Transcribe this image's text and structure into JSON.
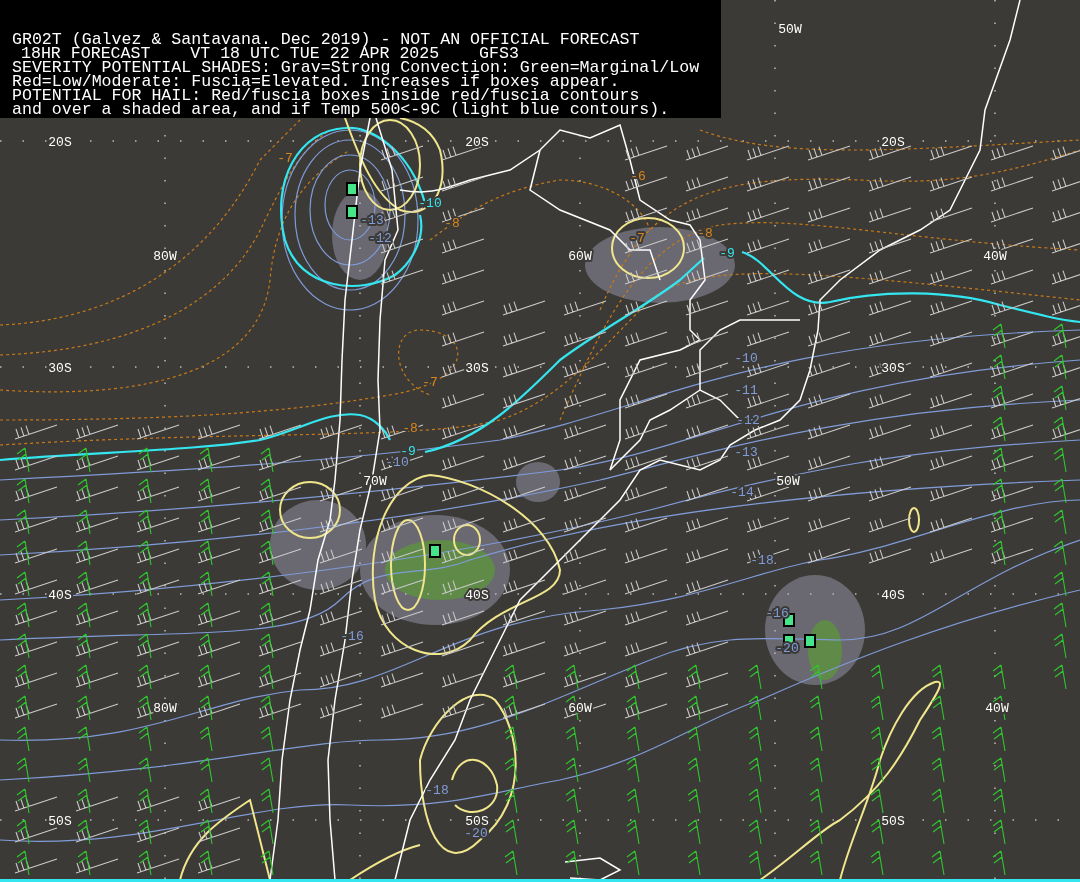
{
  "header": {
    "lines": [
      "GR02T (Galvez & Santavana. Dec 2019) - NOT AN OFFICIAL FORECAST",
      "18HR FORECAST    VT 18 UTC TUE 22 APR 2025    GFS3",
      "SEVERITY POTENTIAL SHADES: Grav=Strong Convection: Green=Marginal/Low",
      "Red=Low/Moderate: Fuscia=Elevated. Increases if boxes appear.",
      "POTENTIAL FOR HAIL: Red/fuscia boxes inside red/fuscia contours",
      "and over a shaded area, and if Temp 500<-9C (light blue contours)."
    ]
  },
  "grid_labels": [
    "50W",
    "20S",
    "20S",
    "20S",
    "80W",
    "60W",
    "40W",
    "30S",
    "30S",
    "30S",
    "70W",
    "50W",
    "40S",
    "40S",
    "40S",
    "80W",
    "60W",
    "40W",
    "50S",
    "50S",
    "50S"
  ],
  "contour_labels": [
    {
      "text": "-7",
      "color": "#d9861c"
    },
    {
      "text": "-10",
      "color": "#33e6f0"
    },
    {
      "text": "-13",
      "color": "#7f9bd8"
    },
    {
      "text": "-12",
      "color": "#7f9bd8"
    },
    {
      "text": "-8",
      "color": "#d9861c"
    },
    {
      "text": "-6",
      "color": "#d9861c"
    },
    {
      "text": "-7",
      "color": "#d9861c"
    },
    {
      "text": "-8",
      "color": "#d9861c"
    },
    {
      "text": "-9",
      "color": "#33e6f0"
    },
    {
      "text": "-10",
      "color": "#7f9bd8"
    },
    {
      "text": "-7",
      "color": "#d9861c"
    },
    {
      "text": "-11",
      "color": "#7f9bd8"
    },
    {
      "text": "-8",
      "color": "#d9861c"
    },
    {
      "text": "-12",
      "color": "#7f9bd8"
    },
    {
      "text": "-9",
      "color": "#33e6f0"
    },
    {
      "text": "-13",
      "color": "#7f9bd8"
    },
    {
      "text": "-10",
      "color": "#7f9bd8"
    },
    {
      "text": "-14",
      "color": "#7f9bd8"
    },
    {
      "text": "-16",
      "color": "#7f9bd8"
    },
    {
      "text": "-18",
      "color": "#7f9bd8"
    },
    {
      "text": "-16",
      "color": "#7f9bd8"
    },
    {
      "text": "-20",
      "color": "#7f9bd8"
    },
    {
      "text": "-18",
      "color": "#7f9bd8"
    },
    {
      "text": "-20",
      "color": "#7f9bd8"
    }
  ]
}
